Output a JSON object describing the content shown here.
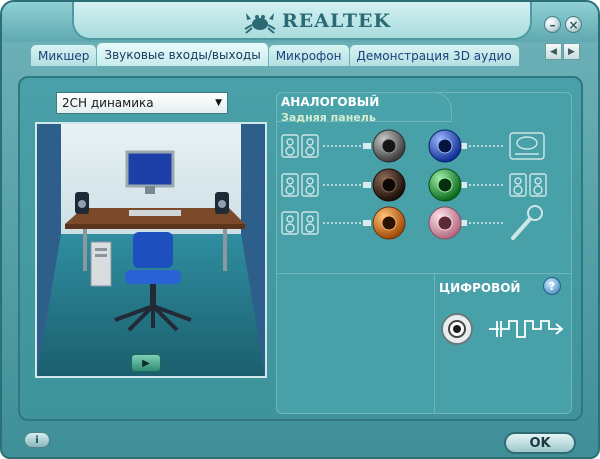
{
  "app": {
    "brand": "REALTEK"
  },
  "window_buttons": {
    "minimize_symbol": "–",
    "close_symbol": "×"
  },
  "tabs": [
    {
      "label": "Микшер"
    },
    {
      "label": "Звуковые входы/выходы"
    },
    {
      "label": "Микрофон"
    },
    {
      "label": "Демонстрация 3D аудио"
    }
  ],
  "active_tab": "Звуковые входы/выходы",
  "tab_scroll": {
    "left": "◀",
    "right": "▶"
  },
  "speaker_config": {
    "selected": "2CH динамика"
  },
  "scene": {
    "play_symbol": "▶"
  },
  "analog": {
    "title": "АНАЛОГОВЫЙ",
    "rear_panel": "Задняя панель",
    "jacks": [
      {
        "color_name": "grey",
        "color": "#6b6b6b",
        "device": "speakers-pair-icon",
        "side": "left"
      },
      {
        "color_name": "black",
        "color": "#2a1a10",
        "device": "speakers-pair-icon",
        "side": "left"
      },
      {
        "color_name": "orange",
        "color": "#d46a1c",
        "device": "speakers-pair-icon",
        "side": "left"
      },
      {
        "color_name": "blue",
        "color": "#1f4fd1",
        "device": "line-in-icon",
        "side": "right"
      },
      {
        "color_name": "green",
        "color": "#1ea23a",
        "device": "speakers-pair-icon",
        "side": "right"
      },
      {
        "color_name": "pink",
        "color": "#e59aae",
        "device": "microphone-icon",
        "side": "right"
      }
    ]
  },
  "digital": {
    "title": "ЦИФРОВОЙ",
    "help_symbol": "?"
  },
  "footer": {
    "info_symbol": "i",
    "ok_label": "OK"
  },
  "colors": {
    "accent": "#3f949c",
    "tab_text": "#1d3f7a",
    "title_text": "#ffffff"
  }
}
